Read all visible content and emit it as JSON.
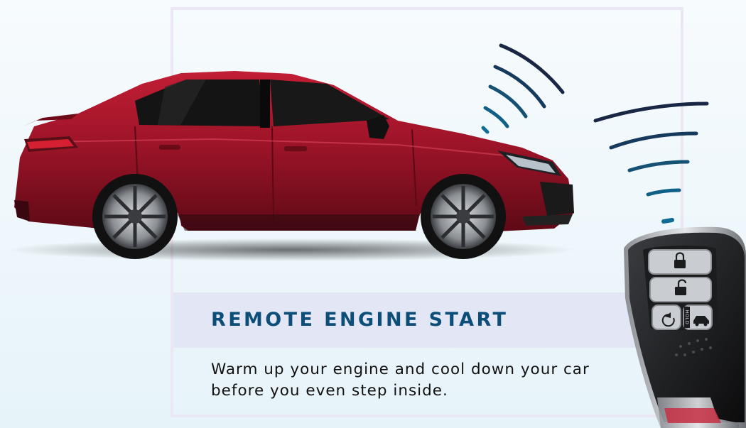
{
  "feature": {
    "title": "REMOTE ENGINE START",
    "description": "Warm up your engine and cool down your car before you even step inside."
  },
  "key_fob": {
    "hold_label": "HOLD",
    "buttons": [
      "lock-icon",
      "unlock-icon",
      "remote-start-icon",
      "trunk-icon"
    ]
  },
  "colors": {
    "car_body": "#9a1326",
    "headline": "#0c4e78",
    "signal_waves": "#0f5f86",
    "band": "#e2e6f5"
  }
}
